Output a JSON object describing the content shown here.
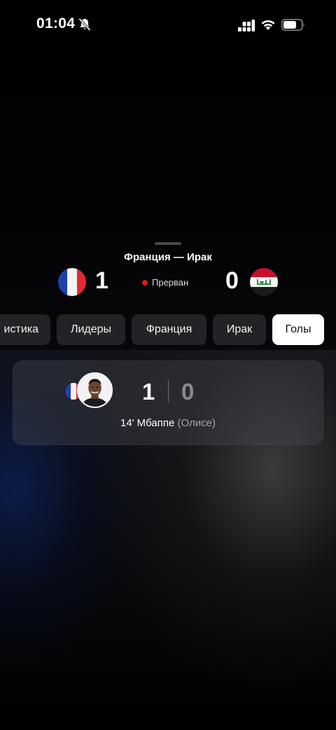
{
  "status_bar": {
    "time": "01:04",
    "icons": [
      "bell-mute-icon",
      "cellular-signal-icon",
      "wifi-icon",
      "battery-icon"
    ]
  },
  "match": {
    "title": "Франция — Ирак",
    "home": {
      "score": "1",
      "flag": "france-flag-icon"
    },
    "away": {
      "score": "0",
      "flag": "iraq-flag-icon"
    },
    "status": "Прерван",
    "status_color": "#e0161b"
  },
  "tabs": [
    {
      "label": "истика",
      "active": false
    },
    {
      "label": "Лидеры",
      "active": false
    },
    {
      "label": "Франция",
      "active": false
    },
    {
      "label": "Ирак",
      "active": false
    },
    {
      "label": "Голы",
      "active": true
    }
  ],
  "goals": [
    {
      "home_score": "1",
      "away_score": "0",
      "minute": "14′",
      "scorer": "Мбаппе",
      "assist": "(Олисе)",
      "team_flag": "france-flag-icon",
      "avatar": "player-avatar"
    }
  ]
}
